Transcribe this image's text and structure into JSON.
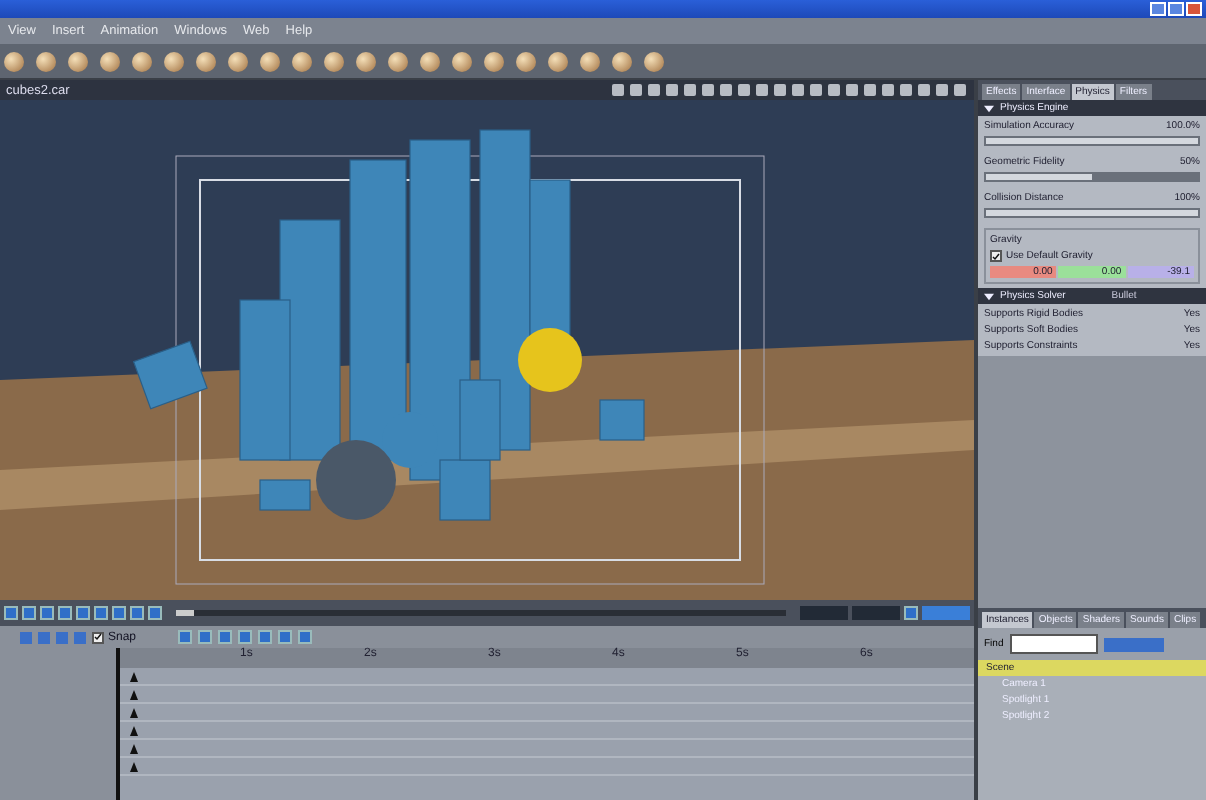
{
  "menu": [
    "View",
    "Insert",
    "Animation",
    "Windows",
    "Web",
    "Help"
  ],
  "document_tab": "cubes2.car",
  "panel_tabs": [
    {
      "label": "Effects",
      "selected": false
    },
    {
      "label": "Interface",
      "selected": false
    },
    {
      "label": "Physics",
      "selected": true
    },
    {
      "label": "Filters",
      "selected": false
    }
  ],
  "physics_engine": {
    "title": "Physics Engine",
    "sliders": [
      {
        "label": "Simulation Accuracy",
        "reading": "100.0%",
        "level": 1.0
      },
      {
        "label": "Geometric Fidelity",
        "reading": "50%",
        "level": 0.5
      },
      {
        "label": "Collision Distance",
        "reading": "100%",
        "level": 1.0
      }
    ],
    "gravity": {
      "title": "Gravity",
      "use_default": {
        "label": "Use Default Gravity",
        "checked": true
      },
      "values": [
        {
          "value": "0.00",
          "color": "#e88a80"
        },
        {
          "value": "0.00",
          "color": "#9be09a"
        },
        {
          "value": "-39.1",
          "color": "#b8b0e8"
        }
      ]
    }
  },
  "physics_solver": {
    "title": "Physics Solver",
    "solver": "Bullet",
    "rows": [
      {
        "label": "Supports Rigid Bodies",
        "value": "Yes"
      },
      {
        "label": "Supports Soft Bodies",
        "value": "Yes"
      },
      {
        "label": "Supports Constraints",
        "value": "Yes"
      }
    ]
  },
  "library_tabs": [
    {
      "label": "Instances",
      "selected": true
    },
    {
      "label": "Objects",
      "selected": false
    },
    {
      "label": "Shaders",
      "selected": false
    },
    {
      "label": "Sounds",
      "selected": false
    },
    {
      "label": "Clips",
      "selected": false
    }
  ],
  "find": {
    "label": "Find"
  },
  "scene_tree": [
    {
      "label": "Scene",
      "selected": true,
      "children": [
        {
          "label": "Camera 1",
          "selected": false
        },
        {
          "label": "Spotlight 1",
          "selected": false
        },
        {
          "label": "Spotlight 2",
          "selected": false
        }
      ]
    }
  ],
  "timeline": {
    "snap": {
      "label": "Snap",
      "checked": true
    },
    "ruler": [
      "1s",
      "2s",
      "3s",
      "4s",
      "5s",
      "6s"
    ],
    "progress": {
      "level": 0.03
    }
  }
}
